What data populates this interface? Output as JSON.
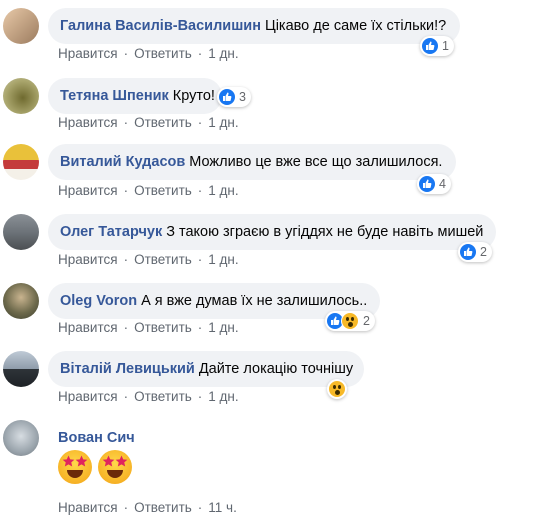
{
  "comments": [
    {
      "author": "Галина Василів-Василишин",
      "text": "Цікаво де саме їх стільки!?",
      "reaction_count": "1",
      "like": "Нравится",
      "reply": "Ответить",
      "time": "1 дн."
    },
    {
      "author": "Тетяна Шпеник",
      "text": "Круто!",
      "reaction_count": "3",
      "like": "Нравится",
      "reply": "Ответить",
      "time": "1 дн."
    },
    {
      "author": "Виталий Кудасов",
      "text": "Можливо це вже все що залишилося.",
      "reaction_count": "4",
      "like": "Нравится",
      "reply": "Ответить",
      "time": "1 дн."
    },
    {
      "author": "Олег Татарчук",
      "text": "З такою зграєю в угіддях не буде навіть мишей",
      "reaction_count": "2",
      "like": "Нравится",
      "reply": "Ответить",
      "time": "1 дн."
    },
    {
      "author": "Oleg Voron",
      "text": "А я вже думав їх не залишилось..",
      "reaction_count": "2",
      "like": "Нравится",
      "reply": "Ответить",
      "time": "1 дн."
    },
    {
      "author": "Віталій Левицький",
      "text": "Дайте локацію точнішу",
      "reaction_count": "",
      "like": "Нравится",
      "reply": "Ответить",
      "time": "1 дн."
    },
    {
      "author": "Вован Сич",
      "text": "",
      "reaction_count": "",
      "like": "Нравится",
      "reply": "Ответить",
      "time": "11 ч."
    }
  ],
  "colors": {
    "author": "#365899",
    "bubble": "#f0f2f5",
    "like": "#1877f2",
    "wow": "#f7b928"
  }
}
